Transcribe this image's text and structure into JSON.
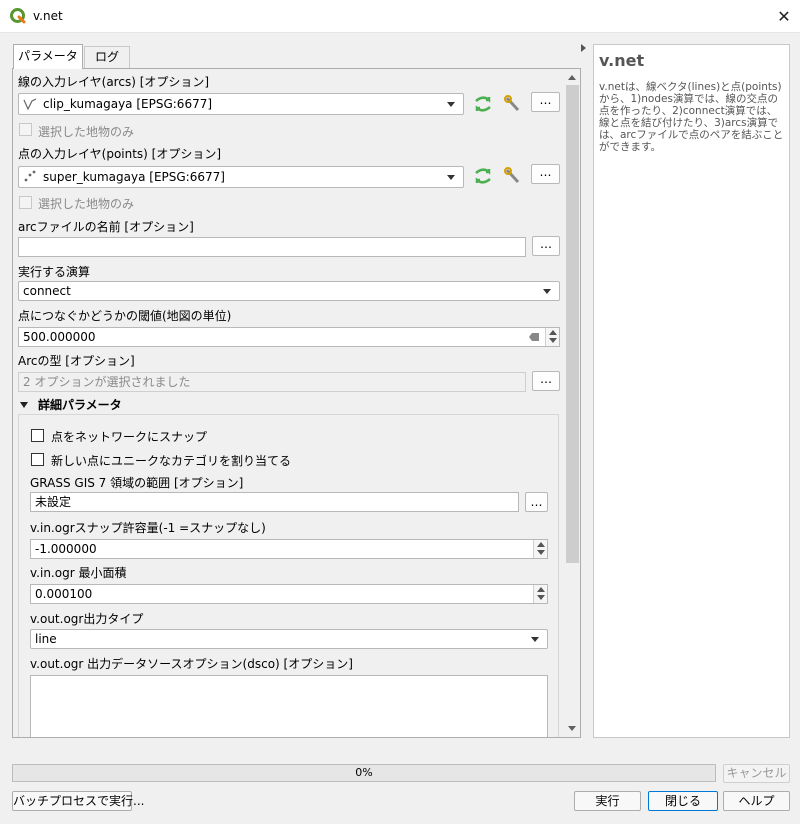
{
  "window": {
    "title": "v.net",
    "close_glyph": "✕",
    "app_icon": "qgis-logo-icon"
  },
  "tabs": [
    {
      "label": "パラメータ",
      "active": true
    },
    {
      "label": "ログ",
      "active": false
    }
  ],
  "params": {
    "arcs_label": "線の入力レイヤ(arcs) [オプション]",
    "arcs_value": "clip_kumagaya [EPSG:6677]",
    "arcs_selected_only": "選択した地物のみ",
    "points_label": "点の入力レイヤ(points) [オプション]",
    "points_value": "super_kumagaya [EPSG:6677]",
    "points_selected_only": "選択した地物のみ",
    "arcfile_label": "arcファイルの名前 [オプション]",
    "arcfile_value": "",
    "operation_label": "実行する演算",
    "operation_value": "connect",
    "threshold_label": "点につなぐかどうかの閾値(地図の単位)",
    "threshold_value": "500.000000",
    "arctype_label": "Arcの型 [オプション]",
    "arctype_value": "2 オプションが選択されました",
    "dots": "…"
  },
  "advanced": {
    "header": "詳細パラメータ",
    "snap_label": "点をネットワークにスナップ",
    "unique_cat_label": "新しい点にユニークなカテゴリを割り当てる",
    "region_label": "GRASS GIS 7 領域の範囲 [オプション]",
    "region_value": "未設定",
    "snap_tol_label": "v.in.ogrスナップ許容量(-1 =スナップなし)",
    "snap_tol_value": "-1.000000",
    "min_area_label": "v.in.ogr 最小面積",
    "min_area_value": "0.000100",
    "out_type_label": "v.out.ogr出力タイプ",
    "out_type_value": "line",
    "dsco_label": "v.out.ogr 出力データソースオプション(dsco) [オプション]",
    "dsco_value": ""
  },
  "help": {
    "title": "v.net",
    "body": "v.netは、線ベクタ(lines)と点(points)から、1)nodes演算では、線の交点の点を作ったり、2)connect演算では、線と点を結び付けたり、3)arcs演算では、arcファイルで点のペアを結ぶことができます。"
  },
  "progress": {
    "value": 0,
    "text": "0%"
  },
  "buttons": {
    "cancel": "キャンセル",
    "batch": "バッチプロセスで実行...",
    "run": "実行",
    "close": "閉じる",
    "help": "ヘルプ"
  },
  "colors": {
    "qgis_green": "#589632",
    "qgis_yellow": "#ee7913",
    "refresh_green": "#4caf50"
  }
}
